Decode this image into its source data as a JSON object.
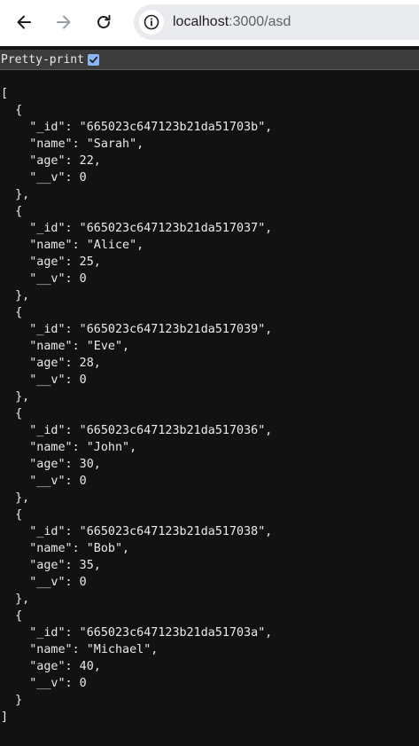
{
  "browser": {
    "url_host": "localhost",
    "url_path": ":3000/asd"
  },
  "viewer": {
    "pretty_print_label": "Pretty-print",
    "pretty_print_checked": true
  },
  "documents": [
    {
      "_id": "665023c647123b21da51703b",
      "name": "Sarah",
      "age": 22,
      "__v": 0
    },
    {
      "_id": "665023c647123b21da517037",
      "name": "Alice",
      "age": 25,
      "__v": 0
    },
    {
      "_id": "665023c647123b21da517039",
      "name": "Eve",
      "age": 28,
      "__v": 0
    },
    {
      "_id": "665023c647123b21da517036",
      "name": "John",
      "age": 30,
      "__v": 0
    },
    {
      "_id": "665023c647123b21da517038",
      "name": "Bob",
      "age": 35,
      "__v": 0
    },
    {
      "_id": "665023c647123b21da51703a",
      "name": "Michael",
      "age": 40,
      "__v": 0
    }
  ]
}
